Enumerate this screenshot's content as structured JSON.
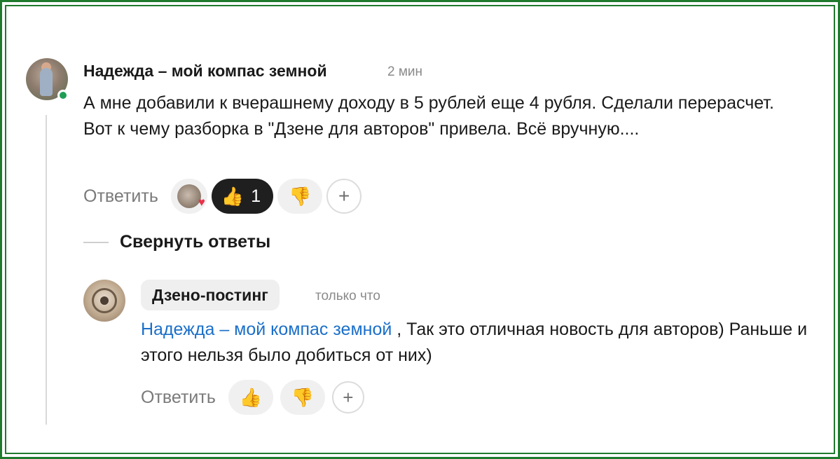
{
  "comment": {
    "author": "Надежда – мой компас земной",
    "time": "2 мин",
    "text": "А мне добавили к вчерашнему доходу в 5 рублей еще 4 рубля. Сделали перерасчет. Вот к чему разборка в \"Дзене для авторов\" привела. Всё вручную....",
    "actions": {
      "reply_label": "Ответить",
      "like_count": "1",
      "add_label": "+"
    }
  },
  "collapse": {
    "label": "Свернуть ответы"
  },
  "reply": {
    "author": "Дзено-постинг",
    "time": "только что",
    "mention": "Надежда – мой компас земной",
    "text": " , Так это отличная новость для авторов) Раньше и этого нельзя было добиться от них)",
    "actions": {
      "reply_label": "Ответить",
      "add_label": "+"
    }
  },
  "icons": {
    "like": "thumbs-up-icon",
    "dislike": "thumbs-down-icon",
    "heart": "heart-icon",
    "add": "plus-icon"
  },
  "colors": {
    "frame": "#1f7a2e",
    "online": "#1f9d55",
    "mention": "#1b6fc9",
    "active_reaction": "#1f1f1f"
  }
}
